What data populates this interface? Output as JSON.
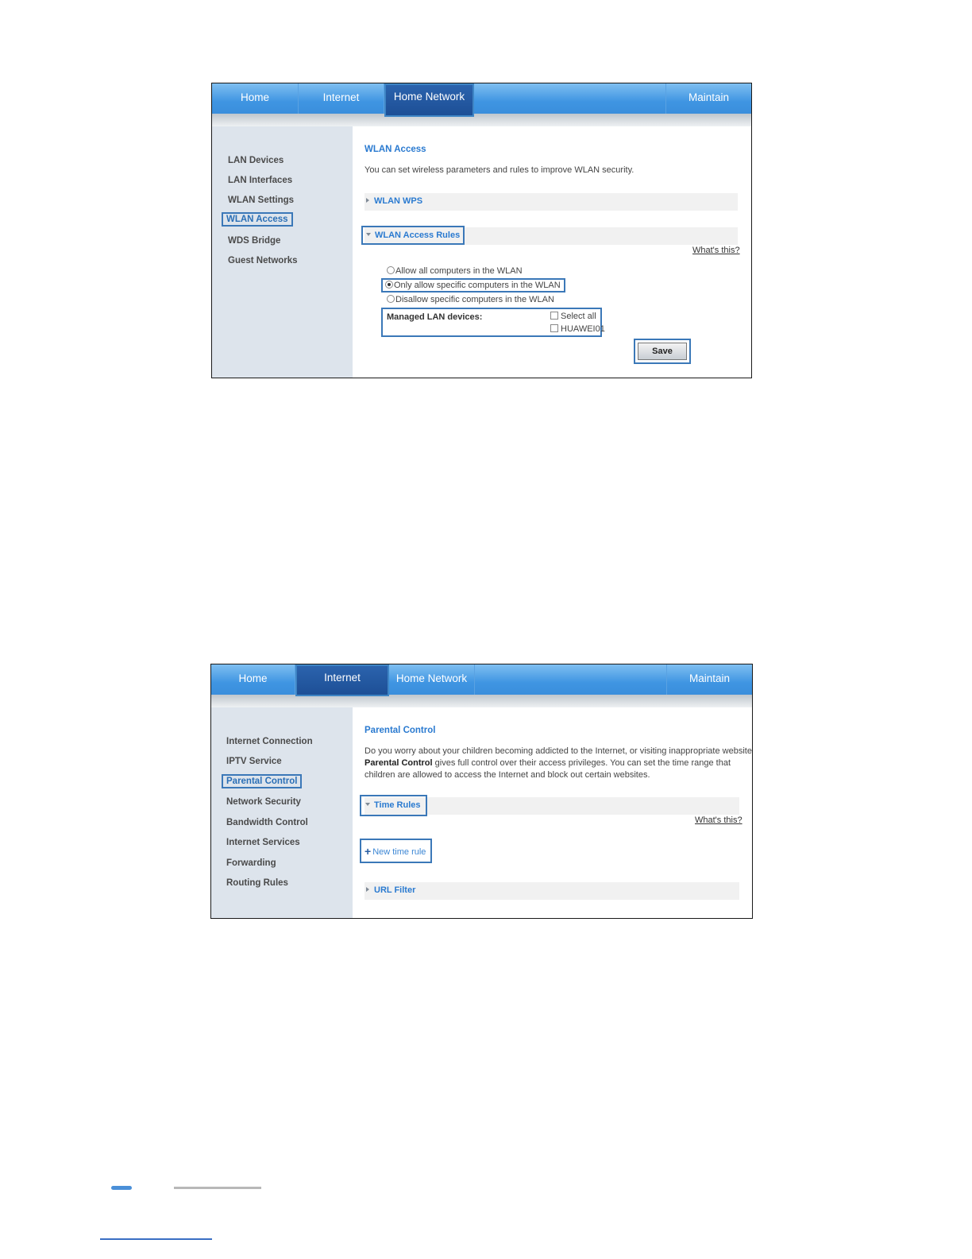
{
  "shot1": {
    "tabs": [
      "Home",
      "Internet",
      "Home Network",
      "Maintain"
    ],
    "sidebar": [
      "LAN Devices",
      "LAN Interfaces",
      "WLAN Settings",
      "WLAN Access",
      "WDS Bridge",
      "Guest Networks"
    ],
    "title": "WLAN Access",
    "description": "You can set wireless parameters and rules to improve WLAN security.",
    "section_wps": "WLAN WPS",
    "section_rules": "WLAN Access Rules",
    "whats_this": "What's this?",
    "radio_options": [
      "Allow all computers in the WLAN",
      "Only allow specific computers in the WLAN",
      "Disallow specific computers in the WLAN"
    ],
    "managed_label": "Managed LAN devices:",
    "select_all": "Select all",
    "device": "HUAWEI01",
    "save": "Save"
  },
  "shot2": {
    "tabs": [
      "Home",
      "Internet",
      "Home Network",
      "Maintain"
    ],
    "sidebar": [
      "Internet Connection",
      "IPTV Service",
      "Parental Control",
      "Network Security",
      "Bandwidth Control",
      "Internet Services",
      "Forwarding",
      "Routing Rules"
    ],
    "title": "Parental Control",
    "desc_line1": "Do you worry about your children becoming addicted to the Internet, or visiting inappropriate websites?",
    "desc_bold": "Parental Control",
    "desc_line2": " gives full control over their access privileges. You can set the time range that",
    "desc_line3": "children are allowed to access the Internet and block out certain websites.",
    "section_time": "Time Rules",
    "whats_this": "What's this?",
    "new_rule": "New time rule",
    "section_url": "URL Filter"
  },
  "colors": {
    "accent": "#3b78b8",
    "nav": "#3f95e2",
    "link": "#2a7ad0"
  }
}
